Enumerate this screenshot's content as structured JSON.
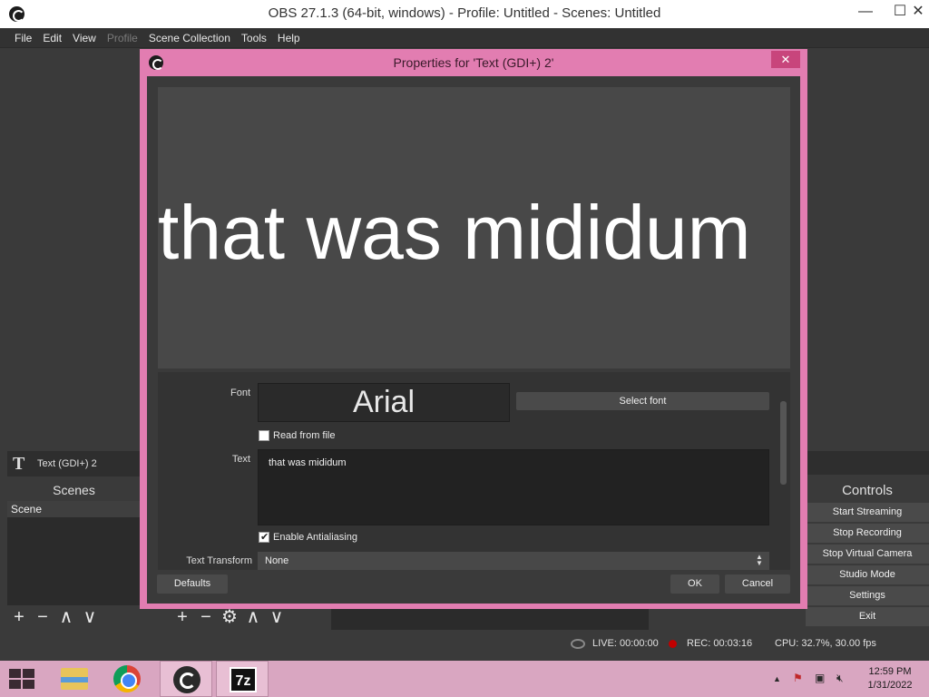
{
  "window": {
    "title": "OBS 27.1.3 (64-bit, windows) - Profile: Untitled - Scenes: Untitled",
    "minimize": "—",
    "maximize": "☐",
    "close": "✕"
  },
  "menu": [
    "File",
    "Edit",
    "View",
    "Profile",
    "Scene Collection",
    "Tools",
    "Help"
  ],
  "source_bar": {
    "icon": "T",
    "label": "Text (GDI+) 2"
  },
  "scenes": {
    "header": "Scenes",
    "items": [
      "Scene"
    ]
  },
  "dock_tools": {
    "add": "+",
    "remove": "−",
    "up": "∧",
    "down": "∨",
    "settings": "⚙"
  },
  "controls": {
    "header": "Controls",
    "buttons": [
      "Start Streaming",
      "Stop Recording",
      "Stop Virtual Camera",
      "Studio Mode",
      "Settings",
      "Exit"
    ]
  },
  "status": {
    "live": "LIVE: 00:00:00",
    "rec": "REC: 00:03:16",
    "cpu": "CPU: 32.7%, 30.00 fps"
  },
  "dialog": {
    "title": "Properties for 'Text (GDI+) 2'",
    "close": "✕",
    "preview_text": "that was mididum",
    "font_label": "Font",
    "font_value": "Arial",
    "select_font": "Select font",
    "read_from_file": "Read from file",
    "read_from_file_checked": false,
    "text_label": "Text",
    "text_value": "that was mididum",
    "antialias": "Enable Antialiasing",
    "antialias_checked": true,
    "transform_label": "Text Transform",
    "transform_value": "None",
    "defaults": "Defaults",
    "ok": "OK",
    "cancel": "Cancel"
  },
  "taskbar": {
    "apps": [
      "file-explorer",
      "chrome",
      "obs",
      "7-zip"
    ],
    "zip_label": "7z",
    "clock_time": "12:59 PM",
    "clock_date": "1/31/2022"
  },
  "colors": {
    "dialog_border": "#e27db1",
    "taskbar": "#d9a6c1",
    "rec_dot": "#c00000"
  }
}
